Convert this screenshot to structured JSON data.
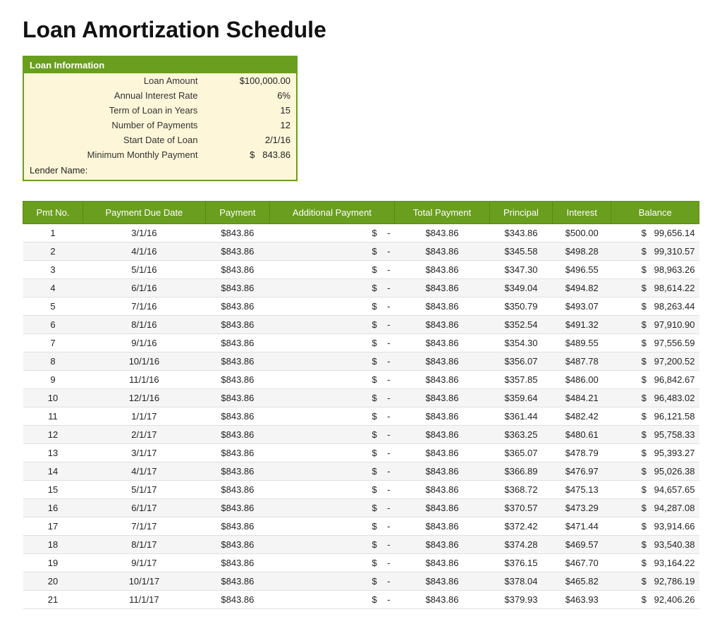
{
  "title": "Loan Amortization Schedule",
  "loanInfo": {
    "header": "Loan Information",
    "fields": [
      {
        "label": "Loan Amount",
        "value": "$100,000.00"
      },
      {
        "label": "Annual Interest Rate",
        "value": "6%"
      },
      {
        "label": "Term of Loan in Years",
        "value": "15"
      },
      {
        "label": "Number of Payments",
        "value": "12"
      },
      {
        "label": "Start Date of Loan",
        "value": "2/1/16"
      },
      {
        "label": "Minimum Monthly Payment",
        "value1": "$",
        "value2": "843.86"
      }
    ],
    "lenderLabel": "Lender Name:"
  },
  "table": {
    "headers": [
      "Pmt No.",
      "Payment Due Date",
      "Payment",
      "Additional Payment",
      "Total Payment",
      "Principal",
      "Interest",
      "Balance"
    ],
    "rows": [
      [
        1,
        "3/1/16",
        "$843.86",
        "$",
        "-",
        "$843.86",
        "$343.86",
        "$500.00",
        "$",
        "99,656.14"
      ],
      [
        2,
        "4/1/16",
        "$843.86",
        "$",
        "-",
        "$843.86",
        "$345.58",
        "$498.28",
        "$",
        "99,310.57"
      ],
      [
        3,
        "5/1/16",
        "$843.86",
        "$",
        "-",
        "$843.86",
        "$347.30",
        "$496.55",
        "$",
        "98,963.26"
      ],
      [
        4,
        "6/1/16",
        "$843.86",
        "$",
        "-",
        "$843.86",
        "$349.04",
        "$494.82",
        "$",
        "98,614.22"
      ],
      [
        5,
        "7/1/16",
        "$843.86",
        "$",
        "-",
        "$843.86",
        "$350.79",
        "$493.07",
        "$",
        "98,263.44"
      ],
      [
        6,
        "8/1/16",
        "$843.86",
        "$",
        "-",
        "$843.86",
        "$352.54",
        "$491.32",
        "$",
        "97,910.90"
      ],
      [
        7,
        "9/1/16",
        "$843.86",
        "$",
        "-",
        "$843.86",
        "$354.30",
        "$489.55",
        "$",
        "97,556.59"
      ],
      [
        8,
        "10/1/16",
        "$843.86",
        "$",
        "-",
        "$843.86",
        "$356.07",
        "$487.78",
        "$",
        "97,200.52"
      ],
      [
        9,
        "11/1/16",
        "$843.86",
        "$",
        "-",
        "$843.86",
        "$357.85",
        "$486.00",
        "$",
        "96,842.67"
      ],
      [
        10,
        "12/1/16",
        "$843.86",
        "$",
        "-",
        "$843.86",
        "$359.64",
        "$484.21",
        "$",
        "96,483.02"
      ],
      [
        11,
        "1/1/17",
        "$843.86",
        "$",
        "-",
        "$843.86",
        "$361.44",
        "$482.42",
        "$",
        "96,121.58"
      ],
      [
        12,
        "2/1/17",
        "$843.86",
        "$",
        "-",
        "$843.86",
        "$363.25",
        "$480.61",
        "$",
        "95,758.33"
      ],
      [
        13,
        "3/1/17",
        "$843.86",
        "$",
        "-",
        "$843.86",
        "$365.07",
        "$478.79",
        "$",
        "95,393.27"
      ],
      [
        14,
        "4/1/17",
        "$843.86",
        "$",
        "-",
        "$843.86",
        "$366.89",
        "$476.97",
        "$",
        "95,026.38"
      ],
      [
        15,
        "5/1/17",
        "$843.86",
        "$",
        "-",
        "$843.86",
        "$368.72",
        "$475.13",
        "$",
        "94,657.65"
      ],
      [
        16,
        "6/1/17",
        "$843.86",
        "$",
        "-",
        "$843.86",
        "$370.57",
        "$473.29",
        "$",
        "94,287.08"
      ],
      [
        17,
        "7/1/17",
        "$843.86",
        "$",
        "-",
        "$843.86",
        "$372.42",
        "$471.44",
        "$",
        "93,914.66"
      ],
      [
        18,
        "8/1/17",
        "$843.86",
        "$",
        "-",
        "$843.86",
        "$374.28",
        "$469.57",
        "$",
        "93,540.38"
      ],
      [
        19,
        "9/1/17",
        "$843.86",
        "$",
        "-",
        "$843.86",
        "$376.15",
        "$467.70",
        "$",
        "93,164.22"
      ],
      [
        20,
        "10/1/17",
        "$843.86",
        "$",
        "-",
        "$843.86",
        "$378.04",
        "$465.82",
        "$",
        "92,786.19"
      ],
      [
        21,
        "11/1/17",
        "$843.86",
        "$",
        "-",
        "$843.86",
        "$379.93",
        "$463.93",
        "$",
        "92,406.26"
      ]
    ]
  }
}
